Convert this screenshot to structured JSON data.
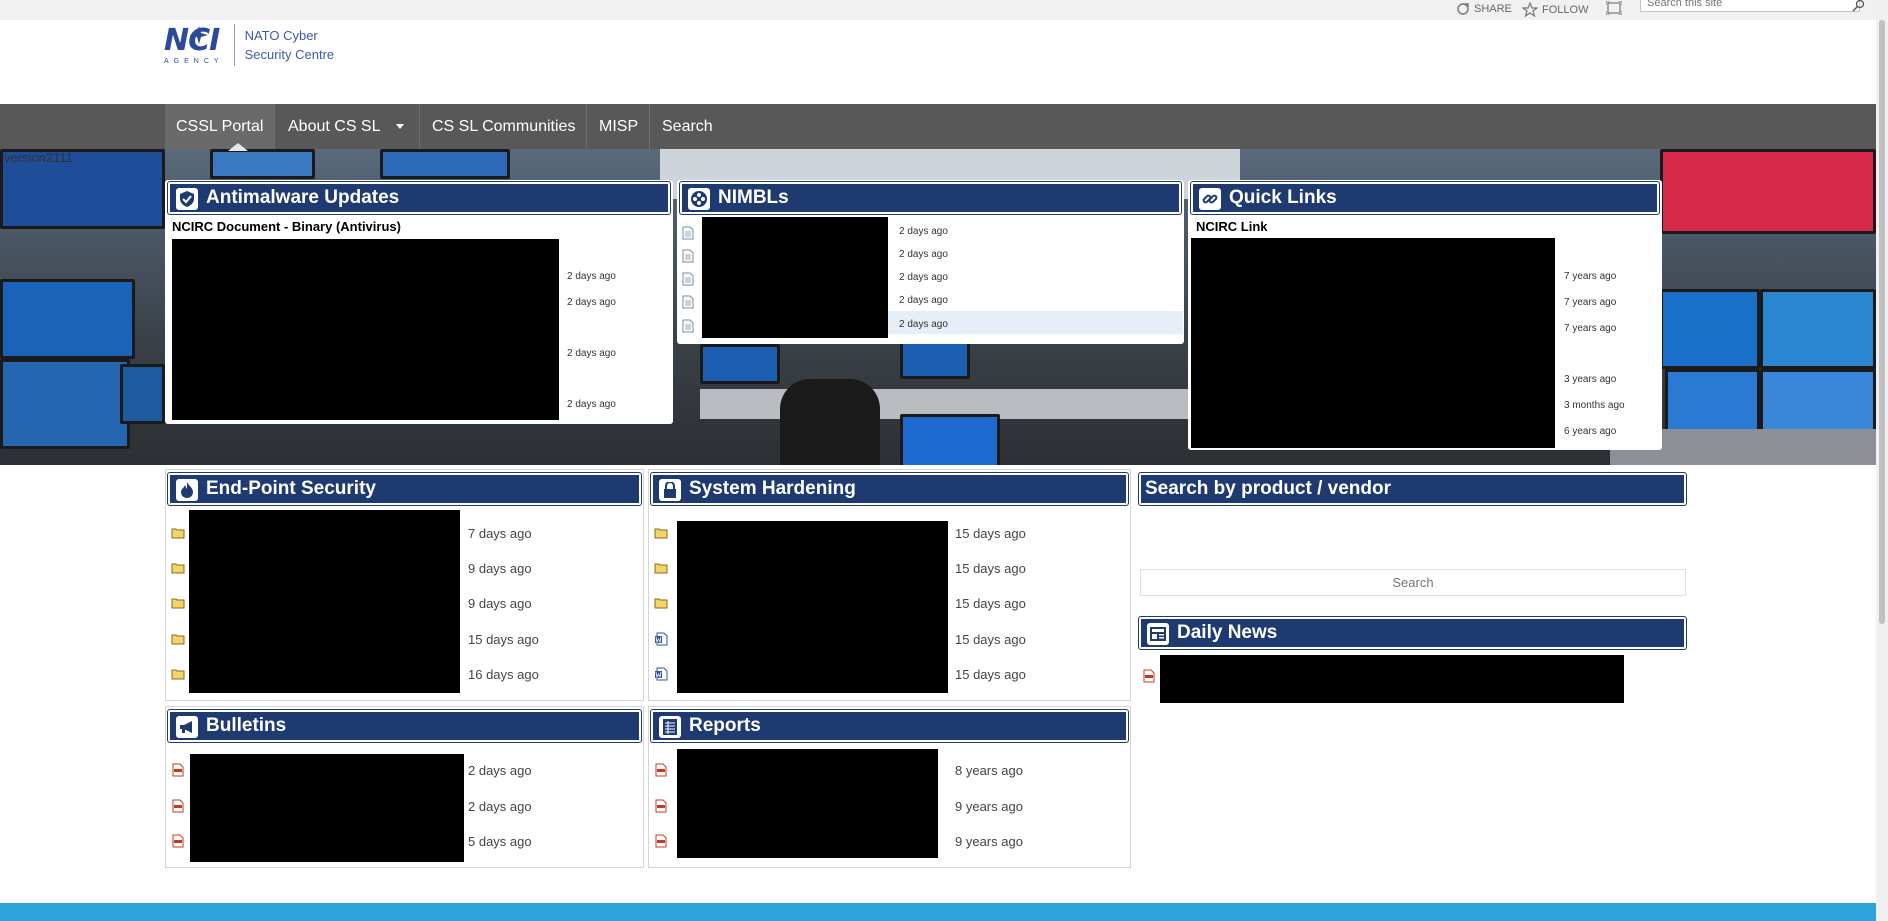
{
  "suite_bar": {
    "share_label": "SHARE",
    "follow_label": "FOLLOW",
    "search_placeholder": "Search this site"
  },
  "header": {
    "logo_text": "NCI",
    "logo_sub": "AGENCY",
    "tagline_1": "NATO Cyber",
    "tagline_2": "Security Centre"
  },
  "nav": {
    "items": [
      {
        "label": "CSSL Portal"
      },
      {
        "label": "About CS SL"
      },
      {
        "label": "CS SL Communities"
      },
      {
        "label": "MISP"
      },
      {
        "label": "Search"
      }
    ]
  },
  "version_text": "version2111",
  "antimalware": {
    "title": "Antimalware Updates",
    "subtitle": "NCIRC Document - Binary (Antivirus)",
    "times": [
      "2 days ago",
      "2 days ago",
      "2 days ago",
      "2 days ago"
    ]
  },
  "nimbls": {
    "title": "NIMBLs",
    "times": [
      "2 days ago",
      "2 days ago",
      "2 days ago",
      "2 days ago",
      "2 days ago"
    ]
  },
  "quicklinks": {
    "title": "Quick Links",
    "subtitle": "NCIRC Link",
    "times": [
      "7 years ago",
      "7 years ago",
      "7 years ago",
      "3 years ago",
      "3 months ago",
      "6 years ago"
    ]
  },
  "endpoint": {
    "title": "End-Point Security",
    "times": [
      "7 days ago",
      "9 days ago",
      "9 days ago",
      "15 days ago",
      "16 days ago"
    ]
  },
  "hardening": {
    "title": "System Hardening",
    "times": [
      "15 days ago",
      "15 days ago",
      "15 days ago",
      "15 days ago",
      "15 days ago"
    ]
  },
  "search_product": {
    "title": "Search by product / vendor",
    "placeholder": "Search"
  },
  "daily_news": {
    "title": "Daily News"
  },
  "bulletins": {
    "title": "Bulletins",
    "times": [
      "2 days ago",
      "2 days ago",
      "5 days ago"
    ]
  },
  "reports": {
    "title": "Reports",
    "times": [
      "8 years ago",
      "9 years ago",
      "9 years ago"
    ]
  },
  "colors": {
    "header_blue": "#1f3a70",
    "nav_gray": "#585858",
    "footer_blue": "#2ea3dc"
  }
}
